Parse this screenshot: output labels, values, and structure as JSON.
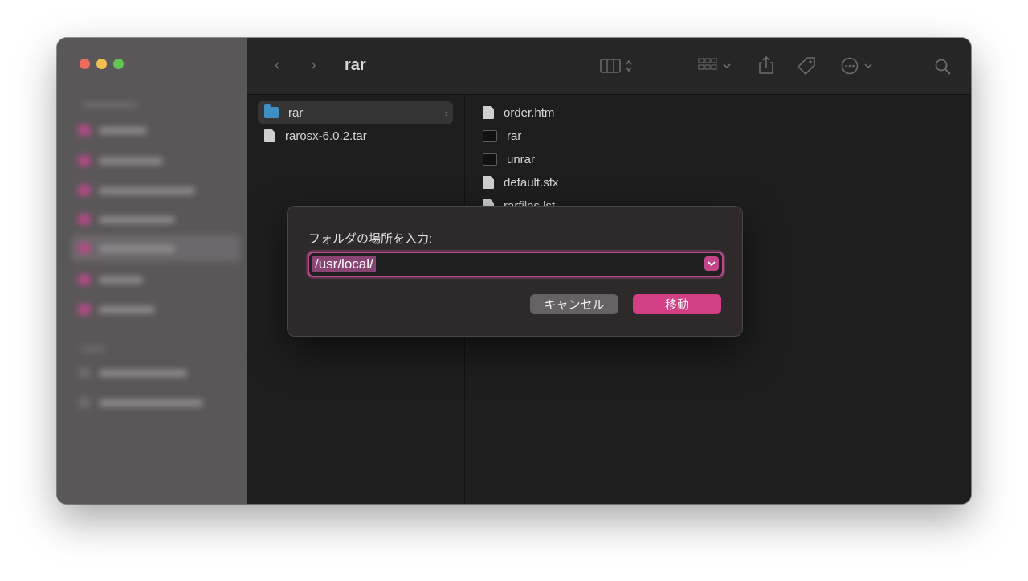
{
  "window": {
    "title": "rar",
    "traffic_colors": [
      "#ed6a5e",
      "#f5bf4f",
      "#62c554"
    ],
    "accent": "#d43e85"
  },
  "toolbar": {
    "back_icon": "chevron-left-icon",
    "forward_icon": "chevron-right-icon",
    "view_icon": "columns-view-icon",
    "group_icon": "grid-icon",
    "share_icon": "share-icon",
    "tag_icon": "tag-icon",
    "more_icon": "ellipsis-circle-icon",
    "search_icon": "search-icon"
  },
  "columns": {
    "col1": [
      {
        "name": "rar",
        "kind": "folder",
        "selected": true
      },
      {
        "name": "rarosx-6.0.2.tar",
        "kind": "document"
      }
    ],
    "col2": [
      {
        "name": "order.htm",
        "kind": "document"
      },
      {
        "name": "rar",
        "kind": "executable"
      },
      {
        "name": "unrar",
        "kind": "executable"
      },
      {
        "name": "default.sfx",
        "kind": "document"
      },
      {
        "name": "rarfiles.lst",
        "kind": "document"
      }
    ]
  },
  "dialog": {
    "label": "フォルダの場所を入力:",
    "path_value": "/usr/local/",
    "dropdown_icon": "chevron-down-icon",
    "cancel_label": "キャンセル",
    "move_label": "移動"
  }
}
